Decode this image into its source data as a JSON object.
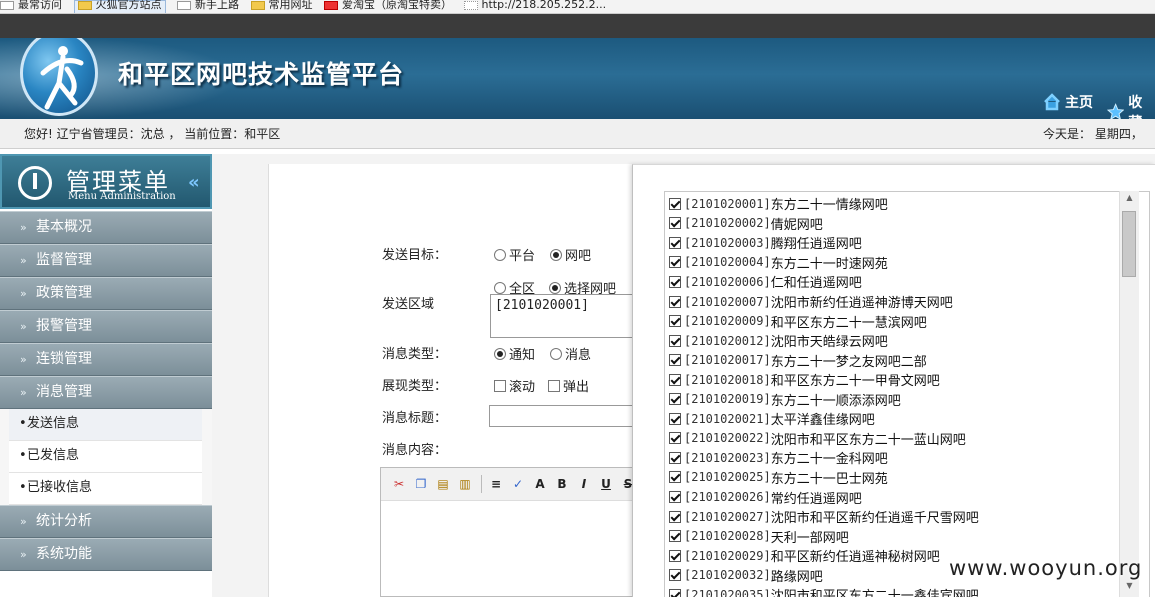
{
  "bookmarks": [
    {
      "label": "最常访问",
      "icon": "page-icon"
    },
    {
      "label": "火狐官方站点",
      "icon": "folder-icon"
    },
    {
      "label": "新手上路",
      "icon": "page-icon"
    },
    {
      "label": "常用网址",
      "icon": "folder-icon"
    },
    {
      "label": "爱淘宝（原淘宝特卖）",
      "icon": "taobao-icon"
    },
    {
      "label": "http://218.205.252.2...",
      "icon": "dotted-page-icon"
    }
  ],
  "header": {
    "title": "和平区网吧技术监管平台",
    "home_label": "主页",
    "favorite_label": "收藏"
  },
  "status": {
    "greeting": "您好! 辽宁省管理员：沈总 ， 当前位置：和平区",
    "today": "今天是： 星期四，"
  },
  "sidebar": {
    "title_zh": "管理菜单",
    "title_en": "Menu Administration",
    "items": [
      {
        "label": "基本概况"
      },
      {
        "label": "监督管理"
      },
      {
        "label": "政策管理"
      },
      {
        "label": "报警管理"
      },
      {
        "label": "连锁管理"
      },
      {
        "label": "消息管理"
      }
    ],
    "sub_items": [
      {
        "label": "发送信息"
      },
      {
        "label": "已发信息"
      },
      {
        "label": "已接收信息"
      }
    ],
    "items_after": [
      {
        "label": "统计分析"
      },
      {
        "label": "系统功能"
      }
    ]
  },
  "form": {
    "target_label": "发送目标：",
    "target_options": [
      "平台",
      "网吧"
    ],
    "target_selected": "网吧",
    "area_label": "发送区域",
    "area_options": [
      "全区",
      "选择网吧"
    ],
    "area_selected": "选择网吧",
    "area_value": "[2101020001]",
    "msg_type_label": "消息类型：",
    "msg_type_options": [
      "通知",
      "消息"
    ],
    "msg_type_selected": "通知",
    "display_label": "展现类型：",
    "display_options": [
      "滚动",
      "弹出"
    ],
    "title_label": "消息标题：",
    "content_label": "消息内容："
  },
  "toolbar": [
    "cut-icon",
    "copy-icon",
    "paste-icon",
    "paste-text-icon",
    "align-icon",
    "spellcheck-icon",
    "font-icon",
    "bold-icon",
    "italic-icon",
    "underline-icon",
    "strikethrough-icon"
  ],
  "netbar_list": [
    {
      "code": "[2101020001]",
      "name": "东方二十一情缘网吧"
    },
    {
      "code": "[2101020002]",
      "name": "倩妮网吧"
    },
    {
      "code": "[2101020003]",
      "name": "腾翔任逍遥网吧"
    },
    {
      "code": "[2101020004]",
      "name": "东方二十一时速网苑"
    },
    {
      "code": "[2101020006]",
      "name": "仁和任逍遥网吧"
    },
    {
      "code": "[2101020007]",
      "name": "沈阳市新约任逍遥神游博天网吧"
    },
    {
      "code": "[2101020009]",
      "name": "和平区东方二十一慧滨网吧"
    },
    {
      "code": "[2101020012]",
      "name": "沈阳市天皓绿云网吧"
    },
    {
      "code": "[2101020017]",
      "name": "东方二十一梦之友网吧二部"
    },
    {
      "code": "[2101020018]",
      "name": "和平区东方二十一甲骨文网吧"
    },
    {
      "code": "[2101020019]",
      "name": "东方二十一顺添添网吧"
    },
    {
      "code": "[2101020021]",
      "name": "太平洋鑫佳缘网吧"
    },
    {
      "code": "[2101020022]",
      "name": "沈阳市和平区东方二十一蓝山网吧"
    },
    {
      "code": "[2101020023]",
      "name": "东方二十一金科网吧"
    },
    {
      "code": "[2101020025]",
      "name": "东方二十一巴士网苑"
    },
    {
      "code": "[2101020026]",
      "name": "常约任逍遥网吧"
    },
    {
      "code": "[2101020027]",
      "name": "沈阳市和平区新约任逍遥千尺雪网吧"
    },
    {
      "code": "[2101020028]",
      "name": "天利一部网吧"
    },
    {
      "code": "[2101020029]",
      "name": "和平区新约任逍遥神秘树网吧"
    },
    {
      "code": "[2101020032]",
      "name": "路缘网吧"
    },
    {
      "code": "[2101020035]",
      "name": "沈阳市和平区东方二十一鑫佳宾网吧"
    }
  ],
  "watermark": "www.wooyun.org"
}
